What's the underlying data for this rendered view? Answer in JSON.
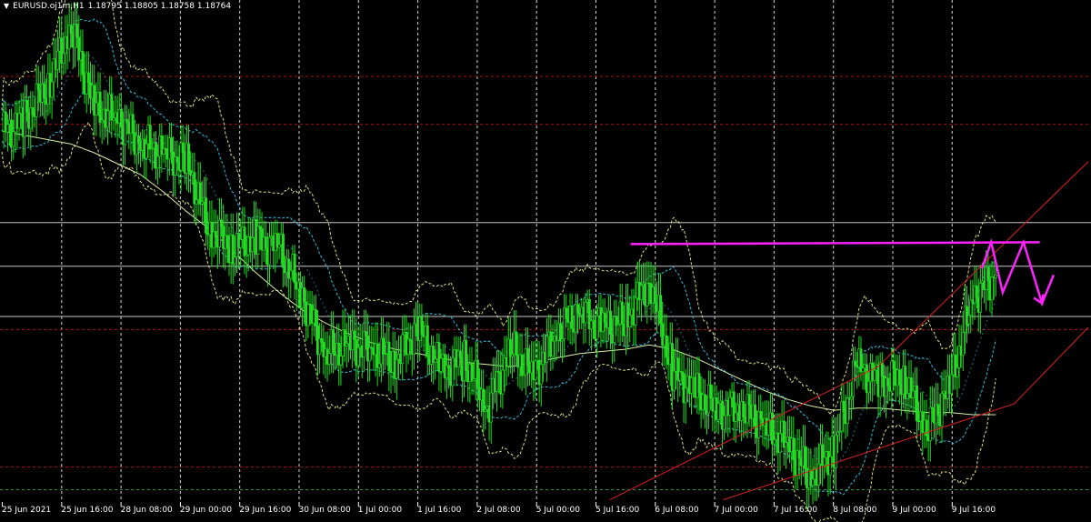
{
  "header": {
    "menu_icon": "triangle-down-icon",
    "symbol": "EURUSD.oj1m,H1",
    "ohlc": "1.18795 1.18805 1.18758 1.18764"
  },
  "colors": {
    "background": "#000000",
    "candles": "#22dd22",
    "bollinger_outer": "#e0e080",
    "bollinger_inner": "#33bbdd",
    "moving_average": "#d8f0a8",
    "channel": "#dd2020",
    "drawing": "#ff22ff",
    "horizontal_levels": "#c8c8c8",
    "dotted_levels": "#b01010",
    "grid": "#ffffff"
  },
  "chart_data": {
    "type": "line",
    "x_tick_labels": [
      "25 Jun 2021",
      "25 Jun 16:00",
      "28 Jun 08:00",
      "29 Jun 00:00",
      "29 Jun 16:00",
      "30 Jun 08:00",
      "1 Jul 00:00",
      "1 Jul 16:00",
      "2 Jul 08:00",
      "5 Jul 00:00",
      "5 Jul 16:00",
      "6 Jul 08:00",
      "7 Jul 00:00",
      "7 Jul 16:00",
      "8 Jul 08:00",
      "9 Jul 00:00",
      "9 Jul 16:00"
    ],
    "close": [
      1.194,
      1.1945,
      1.1962,
      1.1988,
      1.195,
      1.1946,
      1.1935,
      1.193,
      1.1925,
      1.1895,
      1.1887,
      1.189,
      1.1886,
      1.1865,
      1.1838,
      1.1842,
      1.184,
      1.1835,
      1.185,
      1.183,
      1.1836,
      1.1814,
      1.184,
      1.1828,
      1.1848,
      1.1858,
      1.185,
      1.1853,
      1.1873,
      1.183,
      1.182,
      1.1812,
      1.1814,
      1.1805,
      1.1796,
      1.1782,
      1.1795,
      1.1832,
      1.1825,
      1.1828,
      1.1803,
      1.1822,
      1.1864,
      1.1874
    ],
    "moving_average": [
      1.194,
      1.1938,
      1.1936,
      1.1934,
      1.193,
      1.1925,
      1.192,
      1.1912,
      1.1903,
      1.1895,
      1.1885,
      1.1875,
      1.1866,
      1.1858,
      1.1852,
      1.1847,
      1.1843,
      1.184,
      1.1838,
      1.1836,
      1.1834,
      1.1833,
      1.1832,
      1.1834,
      1.1836,
      1.1838,
      1.1839,
      1.184,
      1.1842,
      1.184,
      1.1836,
      1.1831,
      1.1826,
      1.1821,
      1.1817,
      1.1814,
      1.1812,
      1.1813,
      1.1813,
      1.1812,
      1.1811,
      1.1811,
      1.181,
      1.181
    ],
    "horizontal_levels": [
      1.1898,
      1.1878,
      1.1855
    ],
    "dotted_levels": [
      1.1965,
      1.1943,
      1.1849,
      1.1786
    ],
    "resistance_level": 1.1889,
    "channel": {
      "lower": [
        [
          31.2,
          1.1771
        ],
        [
          43.8,
          1.1815
        ],
        [
          47,
          1.185
        ]
      ],
      "upper": [
        [
          26.3,
          1.1771
        ],
        [
          37.9,
          1.1832
        ],
        [
          47,
          1.1926
        ]
      ]
    },
    "projection": [
      [
        42.4,
        1.1877
      ],
      [
        42.8,
        1.1889
      ],
      [
        43.3,
        1.1866
      ],
      [
        44.2,
        1.1889
      ],
      [
        45,
        1.1861
      ],
      [
        45.5,
        1.1874
      ]
    ],
    "y_range": [
      1.177,
      1.2
    ],
    "x_range": [
      0,
      47
    ],
    "grid": true
  }
}
